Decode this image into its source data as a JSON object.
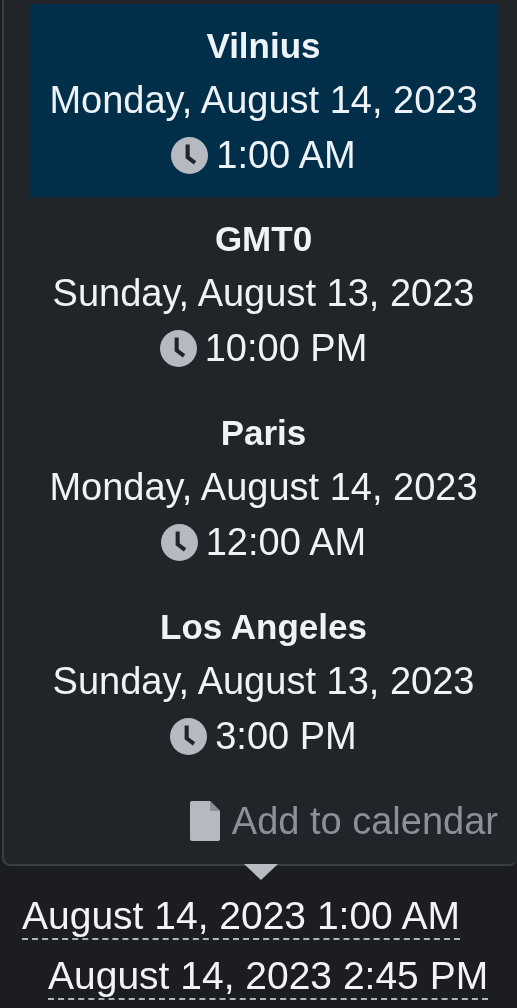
{
  "popover": {
    "zones": [
      {
        "city": "Vilnius",
        "date": "Monday, August 14, 2023",
        "time": "1:00 AM",
        "selected": true
      },
      {
        "city": "GMT0",
        "date": "Sunday, August 13, 2023",
        "time": "10:00 PM",
        "selected": false
      },
      {
        "city": "Paris",
        "date": "Monday, August 14, 2023",
        "time": "12:00 AM",
        "selected": false
      },
      {
        "city": "Los Angeles",
        "date": "Sunday, August 13, 2023",
        "time": "3:00 PM",
        "selected": false
      }
    ],
    "action": {
      "label": "Add to calendar"
    }
  },
  "range": {
    "start": "August 14, 2023 1:00 AM",
    "end": "August 14, 2023 2:45 PM"
  }
}
